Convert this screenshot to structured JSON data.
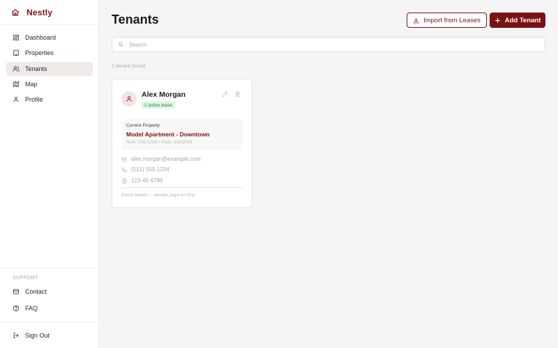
{
  "app": {
    "name": "Nestly",
    "accent_color": "#7a1214",
    "logo_icon": "house-icon"
  },
  "sidebar": {
    "items": [
      {
        "label": "Dashboard",
        "icon": "grid-icon"
      },
      {
        "label": "Properties",
        "icon": "building-icon"
      },
      {
        "label": "Tenants",
        "icon": "users-icon",
        "active": true
      },
      {
        "label": "Map",
        "icon": "map-icon"
      },
      {
        "label": "Profile",
        "icon": "user-icon"
      }
    ],
    "support_label": "SUPPORT",
    "support_items": [
      {
        "label": "Contact",
        "icon": "mail-icon"
      },
      {
        "label": "FAQ",
        "icon": "help-circle-icon"
      }
    ],
    "sign_out": {
      "label": "Sign Out",
      "icon": "log-out-icon"
    }
  },
  "header": {
    "title": "Tenants",
    "import_label": "Import from Leases",
    "add_label": "Add Tenant"
  },
  "search": {
    "placeholder": "Search",
    "value": ""
  },
  "results": {
    "count_text": "1 tenant found"
  },
  "tenant_card": {
    "name": "Alex Morgan",
    "badge": "1 active lease",
    "badge_color": "#2f8a45",
    "property_label": "Current Property",
    "property_name": "Model Apartment - Downtown",
    "property_meta": "Rent: USD 2,000 • Ends: 4/22/2026",
    "email": "alex.morgan@example.com",
    "phone": "(512) 555-1234",
    "ssn": "123-45-6789",
    "notes": "Demo tenant — always pays on time"
  }
}
